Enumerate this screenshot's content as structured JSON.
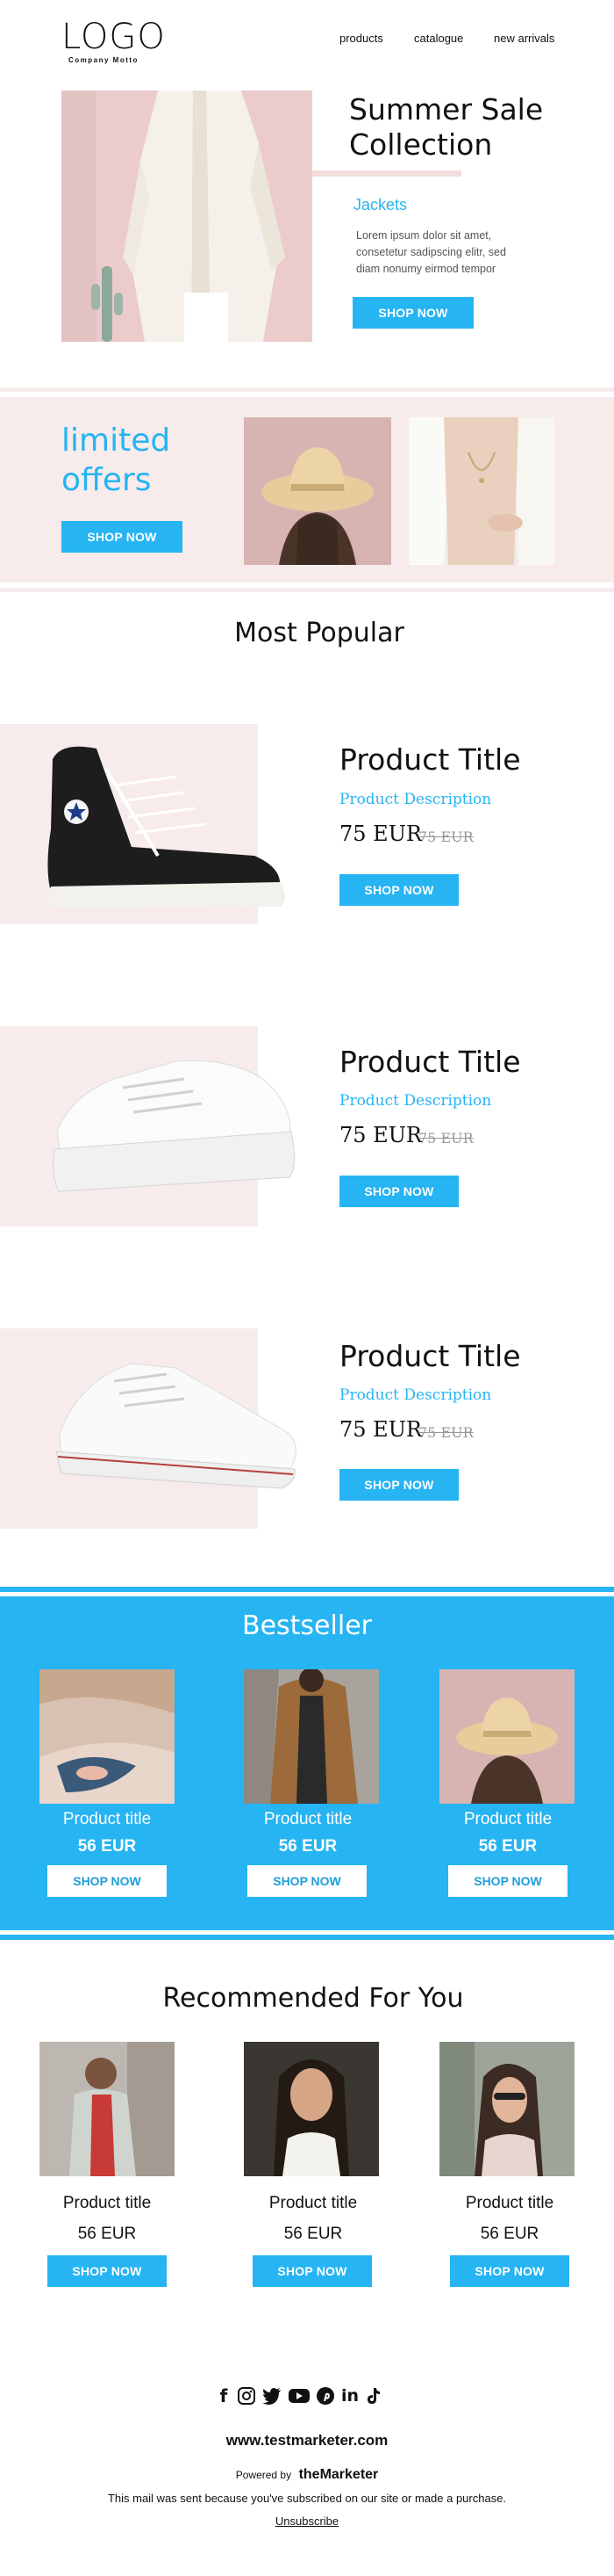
{
  "header": {
    "logo_text": "LOGO",
    "motto": "Company Motto",
    "nav": [
      "products",
      "catalogue",
      "new arrivals"
    ]
  },
  "hero": {
    "title_line1": "Summer Sale",
    "title_line2": "Collection",
    "subtitle": "Jackets",
    "body": [
      "Lorem ipsum dolor sit amet,",
      "consetetur sadipscing elitr, sed",
      "diam nonumy eirmod tempor"
    ],
    "cta": "SHOP NOW"
  },
  "offers": {
    "title_line1": "limited",
    "title_line2": "offers",
    "cta": "SHOP NOW"
  },
  "popular": {
    "heading": "Most Popular",
    "products": [
      {
        "title": "Product Title",
        "description": "Product Description",
        "price": "75 EUR",
        "old_price": "75 EUR",
        "cta": "SHOP NOW"
      },
      {
        "title": "Product Title",
        "description": "Product Description",
        "price": "75 EUR",
        "old_price": "75 EUR",
        "cta": "SHOP NOW"
      },
      {
        "title": "Product Title",
        "description": "Product Description",
        "price": "75 EUR",
        "old_price": "75 EUR",
        "cta": "SHOP NOW"
      }
    ]
  },
  "bestseller": {
    "heading": "Bestseller",
    "items": [
      {
        "title": "Product title",
        "price": "56 EUR",
        "cta": "SHOP NOW"
      },
      {
        "title": "Product title",
        "price": "56 EUR",
        "cta": "SHOP NOW"
      },
      {
        "title": "Product title",
        "price": "56 EUR",
        "cta": "SHOP NOW"
      }
    ]
  },
  "recommended": {
    "heading": "Recommended For You",
    "items": [
      {
        "title": "Product title",
        "price": "56 EUR",
        "cta": "SHOP NOW"
      },
      {
        "title": "Product title",
        "price": "56 EUR",
        "cta": "SHOP NOW"
      },
      {
        "title": "Product title",
        "price": "56 EUR",
        "cta": "SHOP NOW"
      }
    ]
  },
  "footer": {
    "social_icons": [
      "facebook-icon",
      "instagram-icon",
      "twitter-icon",
      "youtube-icon",
      "pinterest-icon",
      "linkedin-icon",
      "tiktok-icon"
    ],
    "website": "www.testmarketer.com",
    "powered_by": "Powered by",
    "brand": "theMarketer",
    "notice": "This mail was sent because you've subscribed on our site or made a purchase.",
    "unsubscribe": "Unsubscribe"
  },
  "colors": {
    "accent": "#26b4f2",
    "pink": "#f7eceb",
    "text": "#111111"
  }
}
